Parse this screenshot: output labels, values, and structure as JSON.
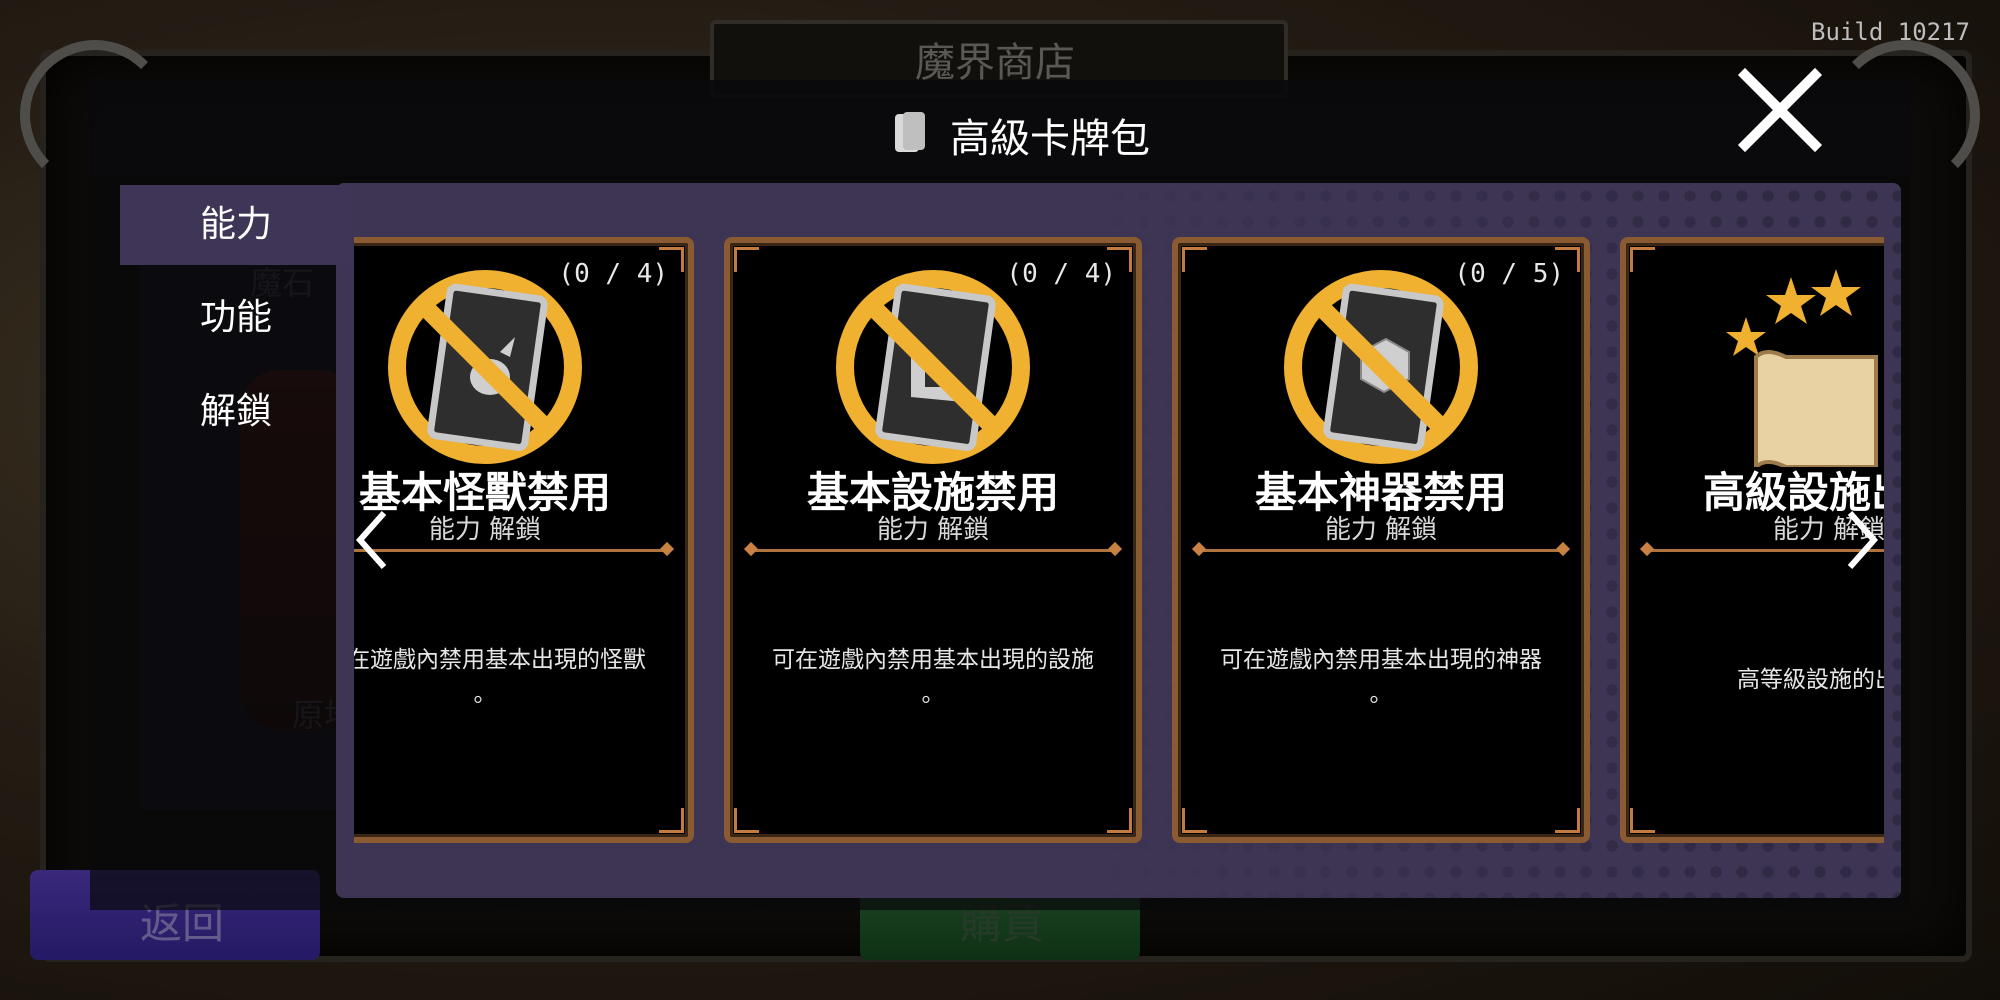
{
  "background": {
    "shop_title": "魔界商店",
    "back_label": "返回",
    "buy_label": "購買",
    "bg_text_1": "魔石",
    "bg_text_2": "原地"
  },
  "build": "Build 10217",
  "modal": {
    "title": "高級卡牌包",
    "header_icon": "card-pack-icon",
    "close_icon": "close-icon"
  },
  "tabs": [
    {
      "label": "能力",
      "active": true
    },
    {
      "label": "功能",
      "active": false
    },
    {
      "label": "解鎖",
      "active": false
    }
  ],
  "cards": [
    {
      "count": "(0 / 4)",
      "title": "基本怪獸禁用",
      "subtitle": "能力 解鎖",
      "description": "可在遊戲內禁用基本出現的怪獸",
      "description_2": "。",
      "icon": "ban-monster-card-icon"
    },
    {
      "count": "(0 / 4)",
      "title": "基本設施禁用",
      "subtitle": "能力 解鎖",
      "description": "可在遊戲內禁用基本出現的設施",
      "description_2": "。",
      "icon": "ban-facility-card-icon"
    },
    {
      "count": "(0 / 5)",
      "title": "基本神器禁用",
      "subtitle": "能力 解鎖",
      "description": "可在遊戲內禁用基本出現的神器",
      "description_2": "。",
      "icon": "ban-artifact-card-icon"
    },
    {
      "count": "",
      "title": "高級設施出現",
      "subtitle": "能力 解鎖",
      "description": "高等級設施的出現",
      "description_2": "",
      "icon": "scroll-stars-icon"
    }
  ],
  "colors": {
    "panel": "#3d3553",
    "card_border": "#8a5a32",
    "accent_gold": "#f0b030"
  }
}
